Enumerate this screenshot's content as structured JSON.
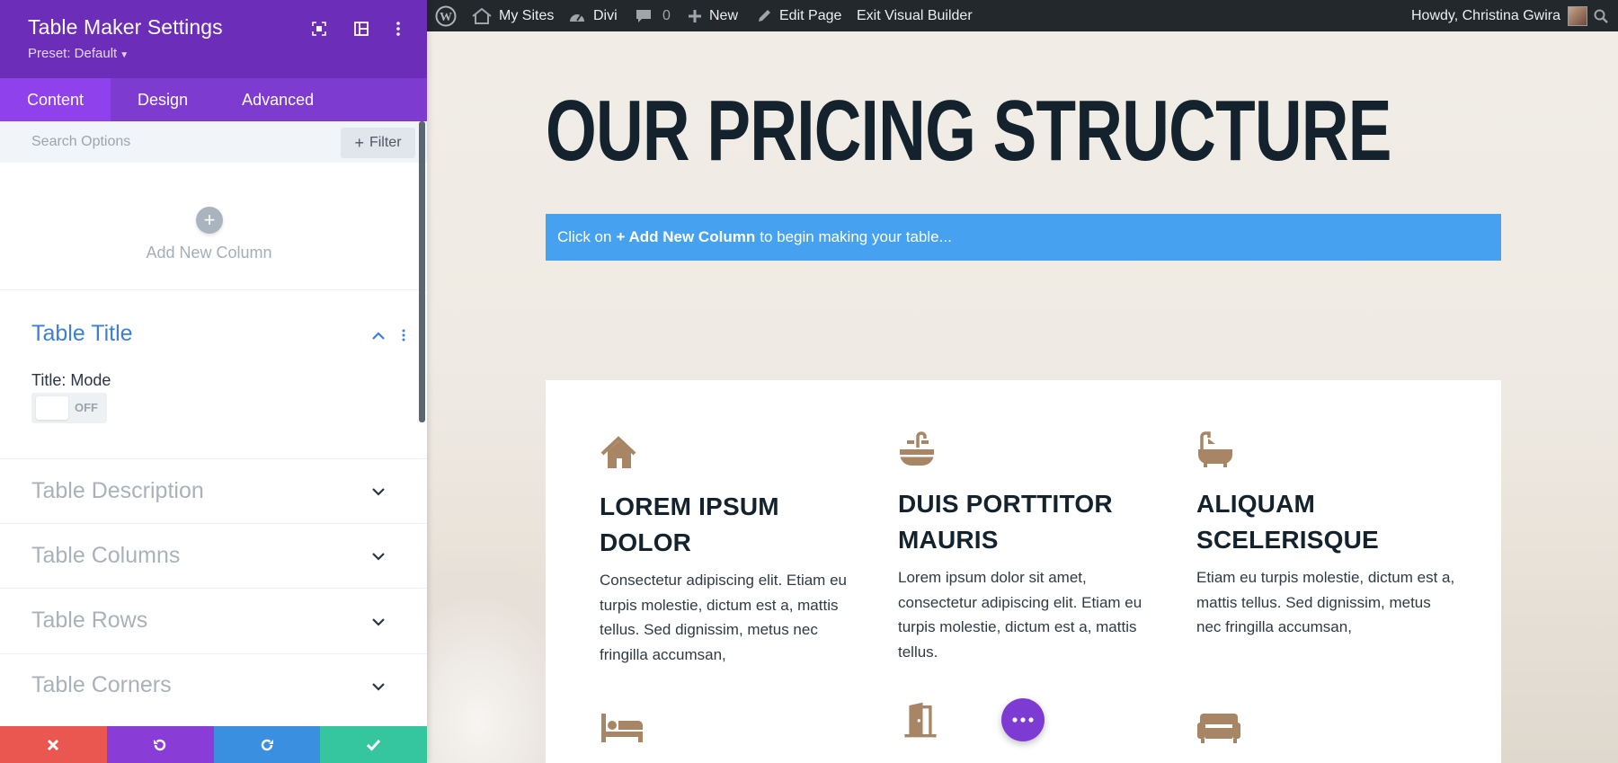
{
  "panel": {
    "title": "Table Maker Settings",
    "preset": "Preset: Default",
    "tabs": [
      {
        "label": "Content"
      },
      {
        "label": "Design"
      },
      {
        "label": "Advanced"
      }
    ],
    "search_placeholder": "Search Options",
    "filter_label": "Filter",
    "add_column_label": "Add New Column",
    "sections": {
      "table_title": {
        "title": "Table Title",
        "field_label": "Title: Mode",
        "toggle_state": "OFF"
      },
      "collapsed": [
        {
          "title": "Table Description"
        },
        {
          "title": "Table Columns"
        },
        {
          "title": "Table Rows"
        },
        {
          "title": "Table Corners"
        }
      ]
    },
    "footer_colors": {
      "cancel": "#ea5751",
      "undo": "#8a3dd6",
      "redo": "#3b8fe0",
      "save": "#35c69f"
    }
  },
  "adminbar": {
    "my_sites": "My Sites",
    "divi": "Divi",
    "comments_count": "0",
    "new": "New",
    "edit_page": "Edit Page",
    "exit_builder": "Exit Visual Builder",
    "greeting": "Howdy, Christina Gwira"
  },
  "page": {
    "heading": "OUR PRICING STRUCTURE",
    "info": {
      "prefix": "Click on",
      "bold": "+ Add New Column",
      "suffix": "to begin making your table..."
    },
    "features": [
      {
        "icon": "house-icon",
        "title": "LOREM IPSUM DOLOR",
        "text": "Consectetur adipiscing elit. Etiam eu turpis molestie, dictum est a, mattis tellus. Sed dignissim, metus nec fringilla accumsan,"
      },
      {
        "icon": "sink-icon",
        "title": "DUIS PORTTITOR MAURIS",
        "text": "Lorem ipsum dolor sit amet, consectetur adipiscing elit. Etiam eu turpis molestie, dictum est a, mattis tellus."
      },
      {
        "icon": "bathtub-icon",
        "title": "ALIQUAM SCELERISQUE",
        "text": "Etiam eu turpis molestie, dictum est a, mattis tellus. Sed dignissim, metus nec fringilla accumsan,"
      }
    ],
    "row2_icons": [
      "bed-icon",
      "door-icon",
      "sofa-icon"
    ],
    "accent_color": "#a88565",
    "info_bar_color": "#46a1f0"
  }
}
